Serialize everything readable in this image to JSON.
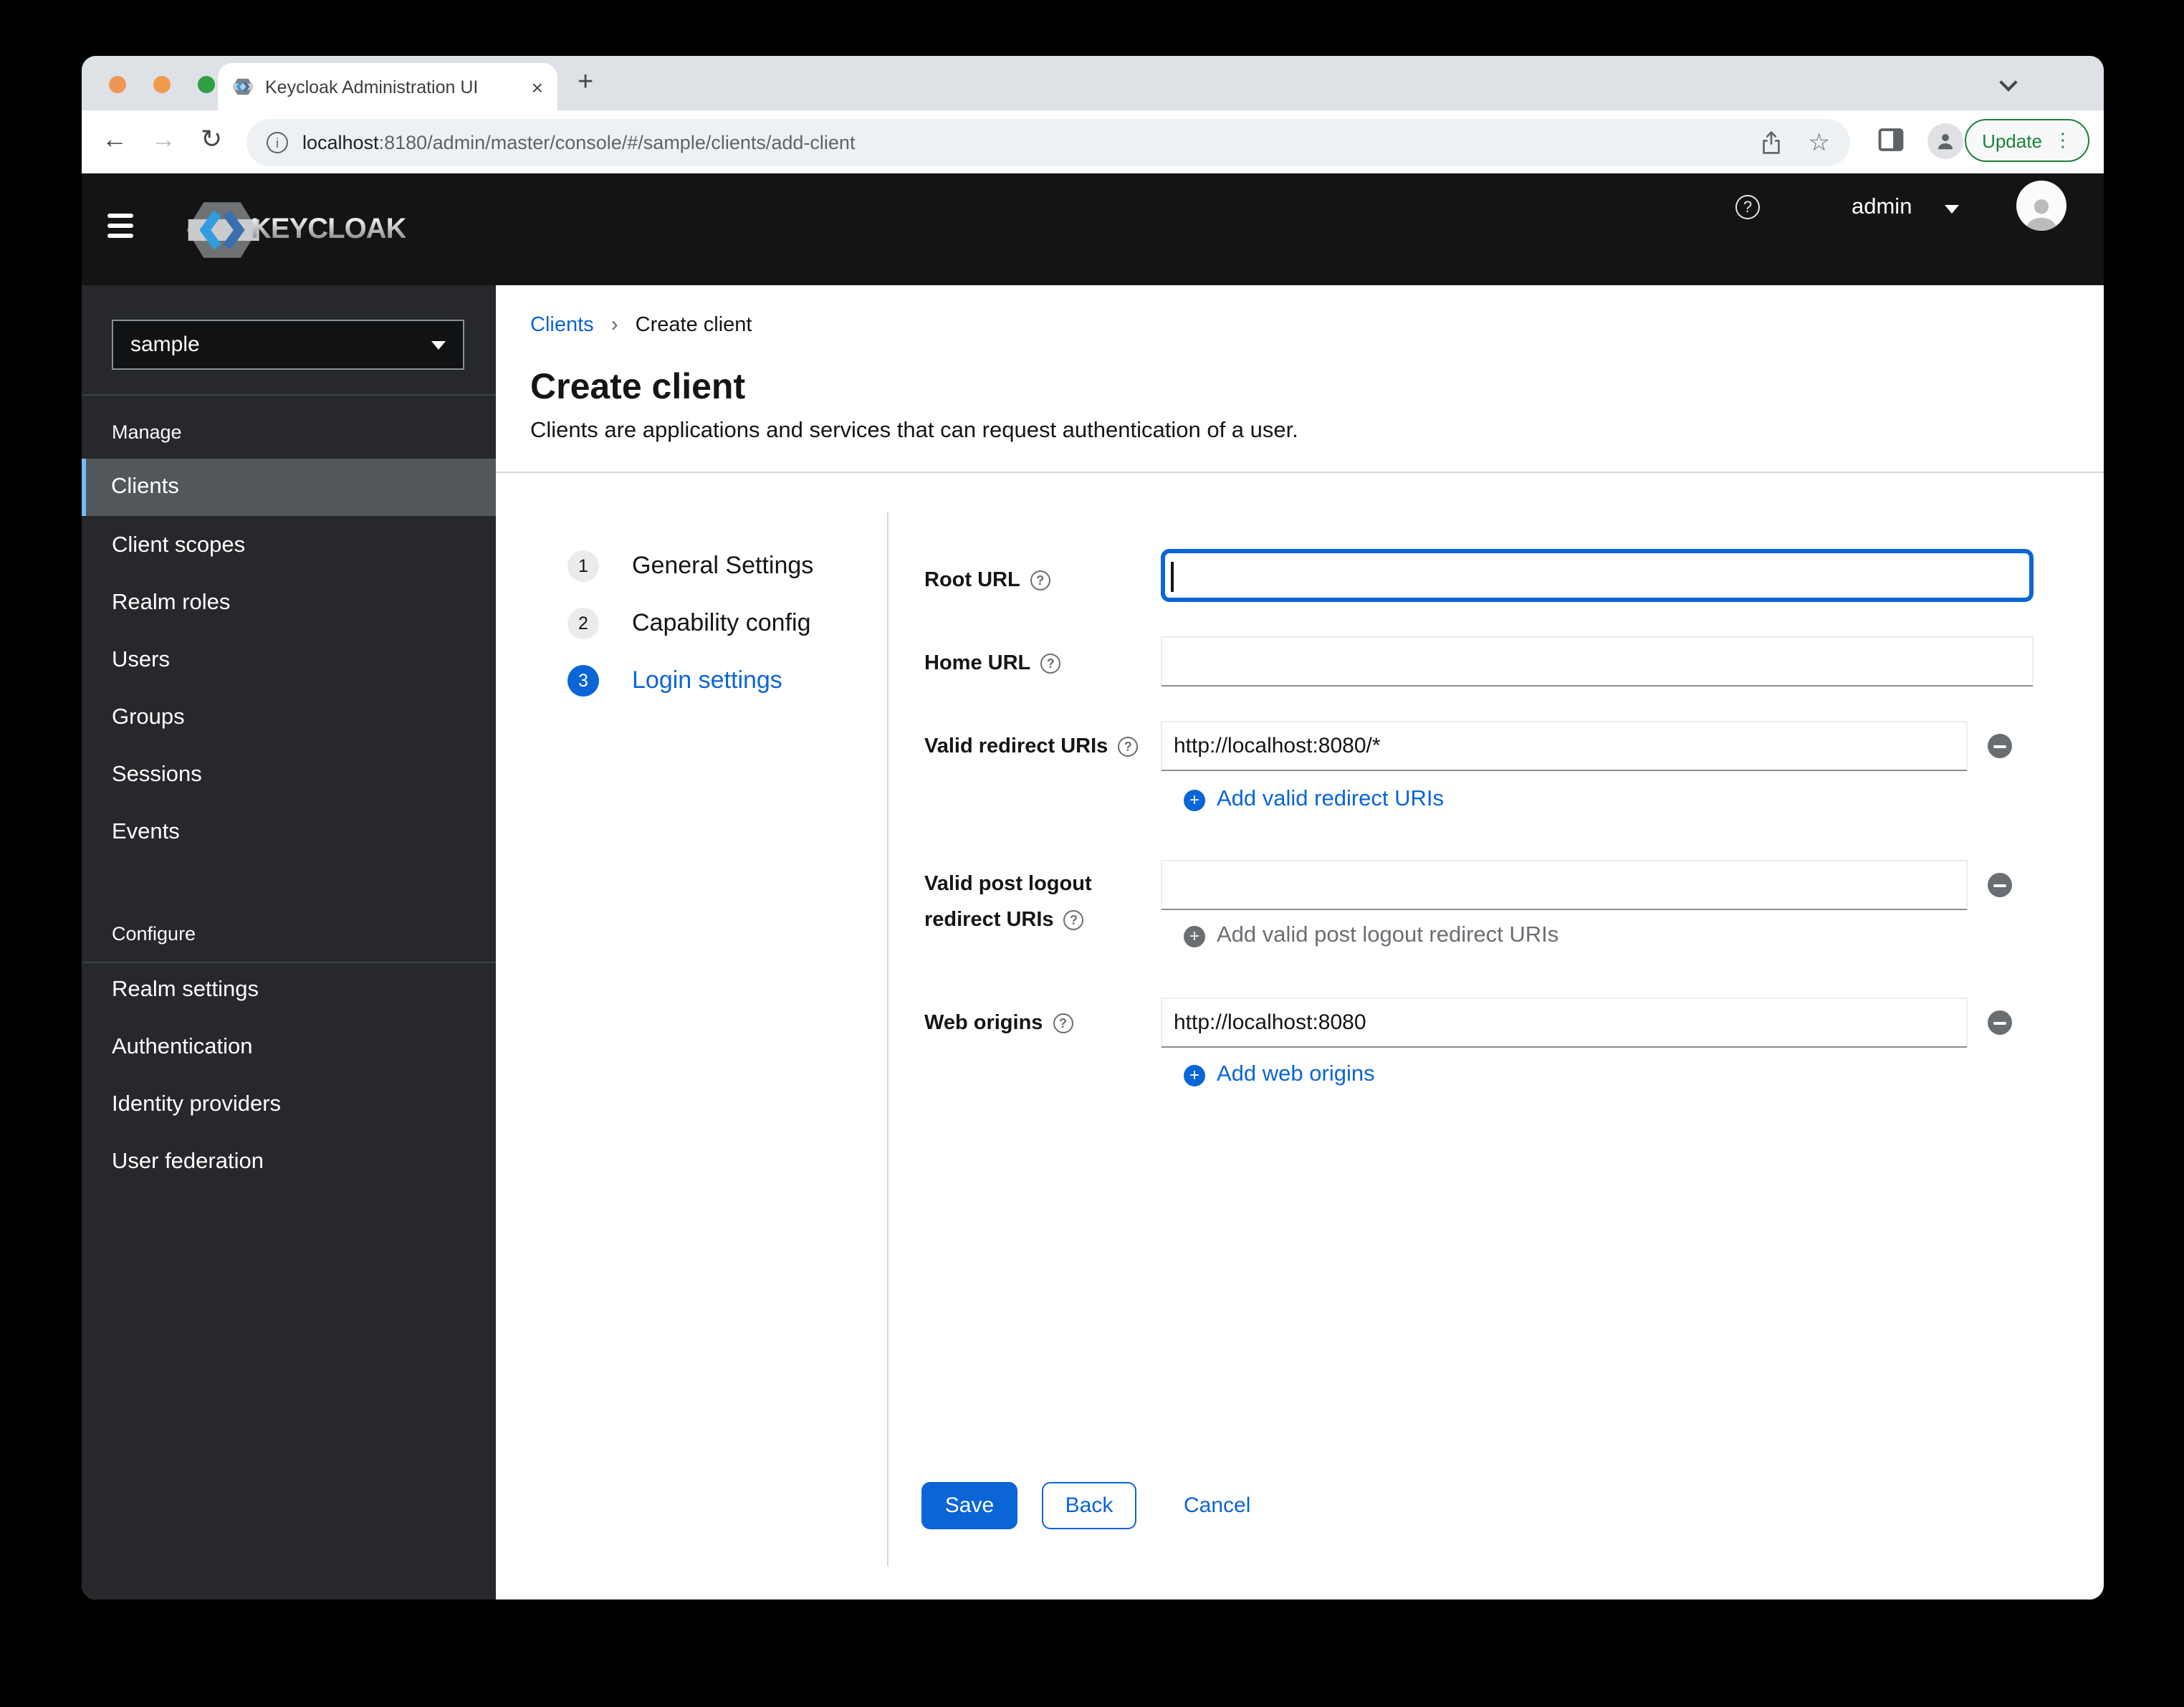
{
  "browser": {
    "tab_title": "Keycloak Administration UI",
    "url": {
      "domain": "localhost",
      "rest": ":8180/admin/master/console/#/sample/clients/add-client"
    },
    "update_label": "Update"
  },
  "icons": {
    "help": "?",
    "info": "i",
    "close": "×",
    "new_tab": "+",
    "star": "☆",
    "kebab": "⋮",
    "back": "←",
    "forward": "→",
    "reload": "↻",
    "breadcrumb_sep": "›",
    "plus": "+",
    "question": "?"
  },
  "header": {
    "brand": "KEYCLOAK",
    "user": "admin"
  },
  "sidebar": {
    "realm": "sample",
    "groups": [
      {
        "label": "Manage",
        "items": [
          "Clients",
          "Client scopes",
          "Realm roles",
          "Users",
          "Groups",
          "Sessions",
          "Events"
        ]
      },
      {
        "label": "Configure",
        "items": [
          "Realm settings",
          "Authentication",
          "Identity providers",
          "User federation"
        ]
      }
    ],
    "selected_item": "Clients"
  },
  "page": {
    "breadcrumb_parent": "Clients",
    "breadcrumb_current": "Create client",
    "title": "Create client",
    "description": "Clients are applications and services that can request authentication of a user."
  },
  "wizard": {
    "steps": [
      {
        "num": "1",
        "label": "General Settings",
        "active": false
      },
      {
        "num": "2",
        "label": "Capability config",
        "active": false
      },
      {
        "num": "3",
        "label": "Login settings",
        "active": true
      }
    ]
  },
  "form": {
    "root_url": {
      "label": "Root URL",
      "value": ""
    },
    "home_url": {
      "label": "Home URL",
      "value": ""
    },
    "redirect_uris": {
      "label": "Valid redirect URIs",
      "value": "http://localhost:8080/*",
      "add_label": "Add valid redirect URIs"
    },
    "post_logout": {
      "label_line1": "Valid post logout",
      "label_line2": "redirect URIs",
      "value": "",
      "add_label": "Add valid post logout redirect URIs"
    },
    "web_origins": {
      "label": "Web origins",
      "value": "http://localhost:8080",
      "add_label": "Add web origins"
    },
    "buttons": {
      "save": "Save",
      "back": "Back",
      "cancel": "Cancel"
    }
  },
  "colors": {
    "primary_blue": "#0a65d6",
    "nav_selected_bar": "#73bcf7",
    "masthead": "#141414",
    "sidebar_bg": "#26282b",
    "nav_selected_bg": "#54575a",
    "update_green": "#1d8038",
    "input_bottom_border": "#8a8d90",
    "disabled_gray": "#6a6e73"
  }
}
